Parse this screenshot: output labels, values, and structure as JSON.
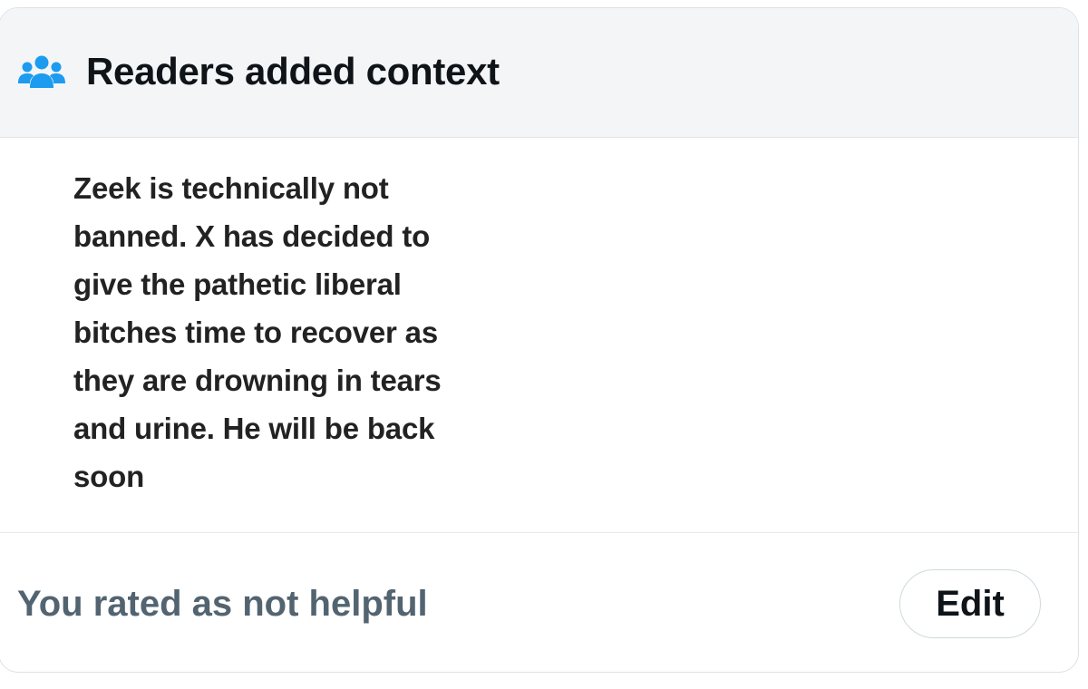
{
  "header": {
    "icon": "people-icon",
    "title": "Readers added context"
  },
  "note": {
    "text": "Zeek is technically not banned. X has decided to give the pathetic liberal bitches time to recover as they are drowning in tears and urine. He will be back soon"
  },
  "footer": {
    "status_label": "You rated as not helpful",
    "edit_label": "Edit"
  },
  "colors": {
    "accent_icon": "#1d9bf0",
    "title_text": "#0f1419",
    "secondary_text": "#536471",
    "header_bg": "#f4f5f7"
  }
}
